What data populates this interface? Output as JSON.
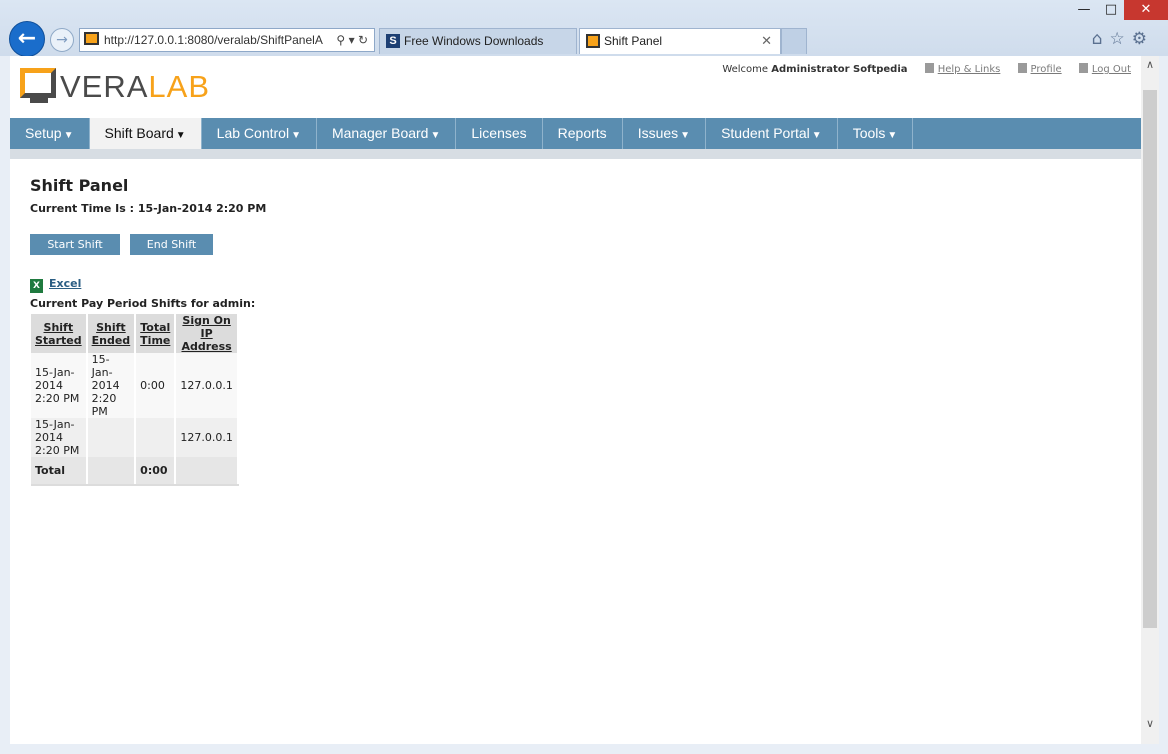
{
  "browser": {
    "address_url": "http://127.0.0.1:8080/veralab/ShiftPanelA",
    "tabs": [
      {
        "label": "Free Windows Downloads",
        "favicon": "softpedia-icon",
        "active": false
      },
      {
        "label": "Shift Panel",
        "favicon": "veralab-icon",
        "active": true
      }
    ]
  },
  "header": {
    "logo_part1": "VERA",
    "logo_part2": "LAB",
    "welcome_prefix": "Welcome",
    "user_name": "Administrator Softpedia",
    "links": {
      "help": "Help & Links",
      "profile": "Profile",
      "logout": "Log Out"
    }
  },
  "menu": {
    "items": [
      {
        "label": "Setup",
        "dropdown": true
      },
      {
        "label": "Shift Board",
        "dropdown": true,
        "active": true
      },
      {
        "label": "Lab Control",
        "dropdown": true
      },
      {
        "label": "Manager Board",
        "dropdown": true
      },
      {
        "label": "Licenses",
        "dropdown": false
      },
      {
        "label": "Reports",
        "dropdown": false
      },
      {
        "label": "Issues",
        "dropdown": true
      },
      {
        "label": "Student Portal",
        "dropdown": true
      },
      {
        "label": "Tools",
        "dropdown": true
      }
    ]
  },
  "page": {
    "title": "Shift Panel",
    "current_time": "Current Time Is : 15-Jan-2014 2:20 PM",
    "start_button": "Start Shift",
    "end_button": "End Shift",
    "excel_link": "Excel",
    "period_caption": "Current Pay Period Shifts for admin:"
  },
  "table": {
    "headers": [
      "Shift Started",
      "Shift Ended",
      "Total Time",
      "Sign On IP Address"
    ],
    "rows": [
      {
        "started_date": "15-Jan-2014",
        "started_time": "2:20 PM",
        "ended_date": "15-Jan-2014",
        "ended_time": "2:20 PM",
        "total": "0:00",
        "ip": "127.0.0.1"
      },
      {
        "started_date": "15-Jan-2014",
        "started_time": "2:20 PM",
        "ended_date": "",
        "ended_time": "",
        "total": "",
        "ip": "127.0.0.1"
      }
    ],
    "total_label": "Total",
    "total_value": "0:00"
  },
  "colors": {
    "menu_bg": "#5a8db0",
    "accent_orange": "#f7a21a",
    "button_bg": "#5a8db0",
    "link": "#2b5e84"
  }
}
